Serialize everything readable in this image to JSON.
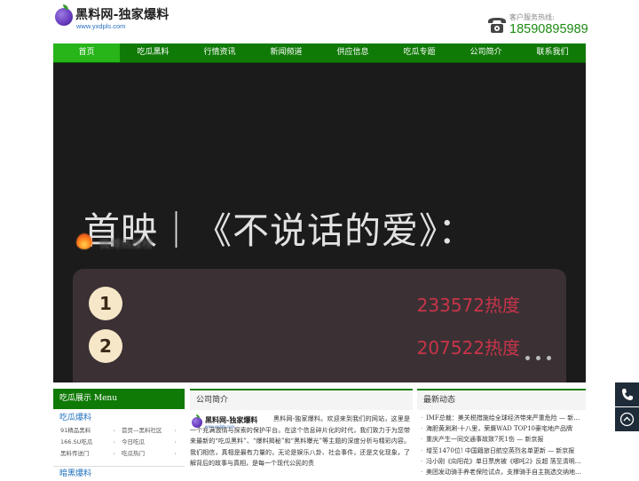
{
  "header": {
    "logo_title": "黑料网-独家爆料",
    "logo_url": "www.yxdpls.com",
    "hotline_label": "客户服务热线:",
    "hotline_number": "18590895989"
  },
  "nav": {
    "items": [
      {
        "label": "首页",
        "active": true
      },
      {
        "label": "吃瓜黑料"
      },
      {
        "label": "行情资讯"
      },
      {
        "label": "新闻频道"
      },
      {
        "label": "供应信息"
      },
      {
        "label": "吃瓜专题"
      },
      {
        "label": "公司简介"
      },
      {
        "label": "联系我们"
      }
    ]
  },
  "banner": {
    "title": "首映｜《不说话的爱》：",
    "ghost_text": "微博热搜榜",
    "ranks": [
      {
        "num": "1",
        "heat": "233572热度"
      },
      {
        "num": "2",
        "heat": "207522热度"
      }
    ],
    "dots": 3
  },
  "menu_block": {
    "head": "吃瓜展示 Menu",
    "category1": "吃瓜爆料",
    "links": [
      "91精品黑料",
      "首页—黑料社区",
      "166.SU吃瓜",
      "今日吃瓜",
      "黑料传送门",
      "吃瓜热门"
    ],
    "category2": "暗黑爆料"
  },
  "about_block": {
    "head": "公司简介",
    "logo_title": "黑料网-独家爆料",
    "logo_url": "www.yxdpls.com",
    "text": "黑料网-独家爆料。欢迎来到我们的网站，这里是一个充满激情与探索的保护平台。在这个信息碎片化的时代，我们致力于为您带来最新的“吃瓜黑料”、“爆料揭秘”和“黑料曝光”等主题的深度分析与精彩内容。我们相信，真相是最有力量的，无论是娱乐八卦、社会事件，还是文化现象，了解背后的故事与真相，是每一个现代公民的责"
  },
  "news_block": {
    "head": "最新动态",
    "items": [
      "IMF总裁：美关税措施给全球经济带来严重危险 — 新…",
      "海胆黄涮涮·十八里，荣膺WAD TOP10豪宅地产品牌",
      "重庆产生一同交通事故致7死1伤 — 新京报",
      "增至1470位! 中国籍旅日航空英烈名单更新 — 新京报",
      "冯小刚《向阳花》单日票房被《哪吒2》反超 落至清明…",
      "美团发动骑手养老保险试点，支撑骑手自主挑选交纳地…"
    ]
  },
  "colors": {
    "nav_green": "#107a07",
    "nav_active": "#27b51a",
    "hotline_green": "#1d8a12",
    "rank_heat_red": "#c8344a",
    "link_blue": "#1d6fbd"
  }
}
